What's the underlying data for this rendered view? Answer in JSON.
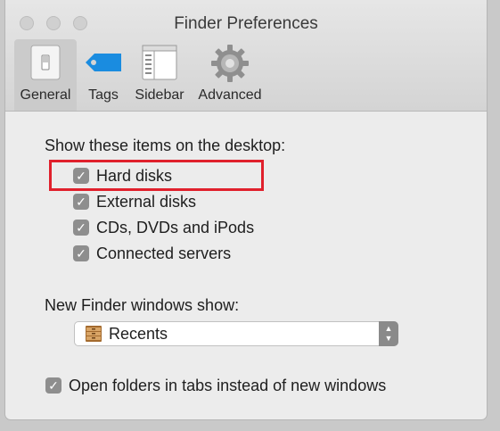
{
  "window": {
    "title": "Finder Preferences"
  },
  "toolbar": {
    "tabs": [
      {
        "label": "General",
        "icon": "switch-icon",
        "selected": true
      },
      {
        "label": "Tags",
        "icon": "tag-icon",
        "selected": false
      },
      {
        "label": "Sidebar",
        "icon": "sidebar-icon",
        "selected": false
      },
      {
        "label": "Advanced",
        "icon": "gear-icon",
        "selected": false
      }
    ]
  },
  "desktop": {
    "heading": "Show these items on the desktop:",
    "items": [
      {
        "label": "Hard disks",
        "checked": true
      },
      {
        "label": "External disks",
        "checked": true
      },
      {
        "label": "CDs, DVDs and iPods",
        "checked": true
      },
      {
        "label": "Connected servers",
        "checked": true
      }
    ]
  },
  "new_window": {
    "heading": "New Finder windows show:",
    "selected": "Recents",
    "icon": "recents-drawer-icon"
  },
  "tabs_option": {
    "label": "Open folders in tabs instead of new windows",
    "checked": true
  },
  "colors": {
    "highlight": "#e0202c",
    "tag_blue": "#1a8ce0",
    "checkbox": "#8e8e8e"
  }
}
